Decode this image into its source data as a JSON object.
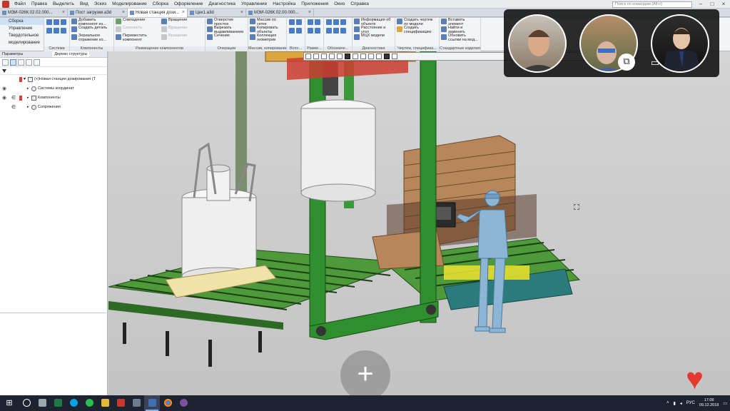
{
  "menu": [
    "Файл",
    "Правка",
    "Выделить",
    "Вид",
    "Эскиз",
    "Моделирование",
    "Сборка",
    "Оформление",
    "Диагностика",
    "Управление",
    "Настройка",
    "Приложения",
    "Окно",
    "Справка"
  ],
  "search_placeholder": "Поиск по командам (Alt+/)",
  "tabs": [
    {
      "label": "МЭИ-026К.02.02.000..."
    },
    {
      "label": "Пост загрузки.a3d"
    },
    {
      "label": "Новая станция дози..."
    },
    {
      "label": "Цех1.a3d"
    },
    {
      "label": "МЭИ-026К.02.00.000..."
    }
  ],
  "ribbon": {
    "left": [
      "Сборка",
      "Управление",
      "Твердотельное",
      "моделирование"
    ],
    "groups": [
      {
        "label": "Система",
        "cmds": []
      },
      {
        "label": "Компоненты",
        "cmds": [
          "Добавить компонент из...",
          "Создать деталь",
          "Зеркальное отражение ко..."
        ]
      },
      {
        "label": "Размещение компонентов",
        "cmds": [
          "Совпадение",
          "Соосность",
          "Переместить компонент",
          "Вращение",
          "Вращение",
          "Вращение"
        ]
      },
      {
        "label": "Операции",
        "cmds": [
          "Отверстие простое",
          "Вырезать выдавливанием",
          "Сечение"
        ]
      },
      {
        "label": "Массив, копирование",
        "cmds": [
          "Массив по сетке",
          "Копировать объекты",
          "Коллекция геометрии"
        ]
      },
      {
        "label": "Вспо...",
        "cmds": []
      },
      {
        "label": "Разме...",
        "cmds": []
      },
      {
        "label": "Обозначе...",
        "cmds": []
      },
      {
        "label": "Диагностика",
        "cmds": [
          "Информация об объекте",
          "Расстояние и угол",
          "МЦХ модели"
        ]
      },
      {
        "label": "Чертеж, специфика...",
        "cmds": [
          "Создать чертеж по модели",
          "Создать спецификацию"
        ]
      },
      {
        "label": "Стандартные изделия",
        "cmds": [
          "Вставить элемент",
          "Найти и заменить",
          "Обновить ссылки на мод..."
        ]
      }
    ]
  },
  "left_panel": {
    "tabs": [
      "Параметры",
      "Дерево структуры"
    ],
    "tree": [
      {
        "label": "(+)Новая станция дозирования (Т",
        "indent": 0
      },
      {
        "label": "Системы координат",
        "indent": 1
      },
      {
        "label": "Компоненты",
        "indent": 1
      },
      {
        "label": "Сопряжения",
        "indent": 1
      }
    ]
  },
  "video_call": {
    "participants": [
      "participant-1",
      "participant-2",
      "participant-3"
    ]
  },
  "taskbar": {
    "apps": [
      "search",
      "task-view",
      "excel",
      "skype",
      "whatsapp",
      "explorer",
      "kompas",
      "calculator",
      "kompas-3d",
      "chrome",
      "viber"
    ],
    "tray": {
      "lang": "РУС",
      "time": "17:09",
      "date": "09.12.2018"
    }
  },
  "colors": {
    "accent": "#2f5ea8",
    "frame_green": "#2f8f2f",
    "heart": "#e23a2f"
  }
}
